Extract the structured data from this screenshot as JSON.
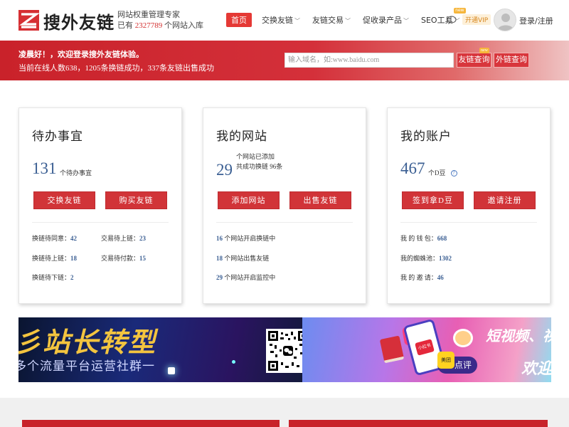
{
  "brand": {
    "name": "搜外友链",
    "slogan_line1": "网站权重管理专家",
    "slogan_prefix": "已有",
    "site_count": "2327789",
    "slogan_suffix": "个网站入库"
  },
  "nav": {
    "items": [
      {
        "label": "首页",
        "active": true
      },
      {
        "label": "交换友链",
        "has_dropdown": true
      },
      {
        "label": "友链交易",
        "has_dropdown": true
      },
      {
        "label": "促收录产品",
        "has_dropdown": true
      },
      {
        "label": "SEO工具",
        "has_dropdown": true,
        "badge": "new"
      }
    ],
    "vip_label": "开通VIP",
    "login_label": "登录/注册"
  },
  "banner": {
    "greeting": "凌晨好！，欢迎登录搜外友链体验。",
    "stats": "当前在线人数638，1205条换链成功，337条友链出售成功",
    "search_placeholder": "输入域名，如:www.baidu.com",
    "friend_query": "友链查询",
    "friend_query_badge": "new",
    "outlink_query": "外链查询"
  },
  "cards": {
    "todo": {
      "title": "待办事宜",
      "count": "131",
      "count_unit": "个待办事宜",
      "btn1": "交换友链",
      "btn2": "购买友链",
      "stats": [
        {
          "label": "换链待同意：",
          "value": "42"
        },
        {
          "label": "交易待上链：",
          "value": "23"
        },
        {
          "label": "换链待上链：",
          "value": "18"
        },
        {
          "label": "交易待付款：",
          "value": "15"
        },
        {
          "label": "换链待下链：",
          "value": "2"
        }
      ]
    },
    "sites": {
      "title": "我的网站",
      "count": "29",
      "line1": "个网站已添加",
      "line2": "共成功换链 96条",
      "btn1": "添加网站",
      "btn2": "出售友链",
      "stats": [
        {
          "value": "16",
          "label": " 个网站开启换链中"
        },
        {
          "value": "18",
          "label": " 个网站出售友链"
        },
        {
          "value": "29",
          "label": " 个网站开启监控中"
        }
      ]
    },
    "account": {
      "title": "我的账户",
      "count": "467",
      "count_unit": "个D豆",
      "help": "?",
      "btn1": "签到拿D豆",
      "btn2": "邀请注册",
      "stats": [
        {
          "label": "我 的 钱 包：",
          "value": "668"
        },
        {
          "label": "我的蜘蛛池：",
          "value": "1302"
        },
        {
          "label": "我 的 邀 请：",
          "value": "46"
        }
      ]
    }
  },
  "promos": {
    "left_big": "彡站长转型",
    "left_sub": "多个流量平台运营社群一",
    "right_line1": "短视频、视",
    "right_line2": "欢迎",
    "xhs_label": "小红书",
    "meituan_label": "美团",
    "dianping_label": "点评"
  },
  "colors": {
    "brand_red": "#d13438",
    "link_blue": "#3b5f93",
    "vip_orange": "#d7861d"
  }
}
